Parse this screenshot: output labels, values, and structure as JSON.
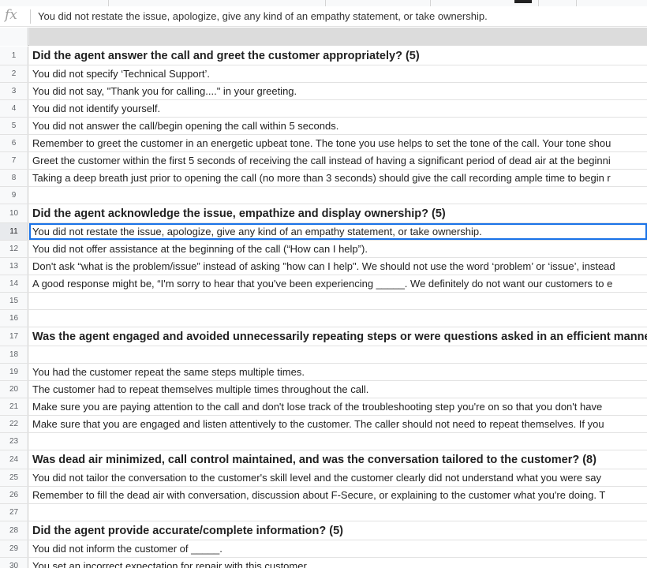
{
  "formula_bar": {
    "fx_label": "fx",
    "content": "You did not restate the issue, apologize, give any kind of an empathy statement, or take ownership."
  },
  "selected_row": "11",
  "rows": [
    {
      "num": "1",
      "text": "Did the agent answer the call and greet the customer appropriately? (5)",
      "kind": "question"
    },
    {
      "num": "2",
      "text": "You did not specify ‘Technical Support’.",
      "kind": "text"
    },
    {
      "num": "3",
      "text": "You did not say, \"Thank you for calling....\" in your greeting.",
      "kind": "text"
    },
    {
      "num": "4",
      "text": "You did not identify yourself.",
      "kind": "text"
    },
    {
      "num": "5",
      "text": "You did not answer the call/begin opening the call within 5 seconds.",
      "kind": "text"
    },
    {
      "num": "6",
      "text": "Remember to greet the customer in an energetic upbeat tone. The tone you use helps to set the tone of the call. Your tone shou",
      "kind": "text"
    },
    {
      "num": "7",
      "text": "Greet the customer within the first 5 seconds of receiving the call instead of having a significant period of dead air at the beginni",
      "kind": "text"
    },
    {
      "num": "8",
      "text": "Taking a deep breath just prior to opening the call (no more than 3 seconds) should give the call recording ample time to begin r",
      "kind": "text"
    },
    {
      "num": "9",
      "text": "",
      "kind": "text"
    },
    {
      "num": "10",
      "text": "Did the agent acknowledge the issue, empathize and display ownership? (5)",
      "kind": "question"
    },
    {
      "num": "11",
      "text": "You did not restate the issue, apologize, give any kind of an empathy statement, or take ownership.",
      "kind": "text"
    },
    {
      "num": "12",
      "text": "You did not offer assistance at the beginning of the call (“How can I help”).",
      "kind": "text"
    },
    {
      "num": "13",
      "text": "Don't ask “what is the problem/issue” instead of asking \"how can I help\". We should not use the word ‘problem’ or ‘issue’, instead",
      "kind": "text"
    },
    {
      "num": "14",
      "text": "A good response might be, “I'm sorry to hear that you've been experiencing _____. We definitely do not want our customers to e",
      "kind": "text"
    },
    {
      "num": "15",
      "text": "",
      "kind": "text"
    },
    {
      "num": "16",
      "text": "",
      "kind": "text"
    },
    {
      "num": "17",
      "text": "Was the agent engaged and avoided unnecessarily repeating steps or were questions asked in an efficient manner",
      "kind": "question"
    },
    {
      "num": "18",
      "text": "",
      "kind": "text"
    },
    {
      "num": "19",
      "text": "You had the customer repeat the same steps multiple times.",
      "kind": "text"
    },
    {
      "num": "20",
      "text": "The customer had to repeat themselves multiple times throughout the call.",
      "kind": "text"
    },
    {
      "num": "21",
      "text": "Make sure you are paying attention to the call and don't lose track of the troubleshooting step you're on so that you don't have",
      "kind": "text"
    },
    {
      "num": "22",
      "text": "Make sure that you are engaged and listen attentively to the customer. The caller should not need to repeat themselves. If you",
      "kind": "text"
    },
    {
      "num": "23",
      "text": "",
      "kind": "text"
    },
    {
      "num": "24",
      "text": "Was dead air minimized, call control maintained, and was the conversation tailored to the customer? (8)",
      "kind": "question"
    },
    {
      "num": "25",
      "text": "You did not tailor the conversation to the customer's skill level and the customer clearly did not understand what you were say",
      "kind": "text"
    },
    {
      "num": "26",
      "text": "Remember to fill the dead air with conversation, discussion about F-Secure, or explaining to the customer what you're doing. T",
      "kind": "text"
    },
    {
      "num": "27",
      "text": "",
      "kind": "text"
    },
    {
      "num": "28",
      "text": "Did the agent provide accurate/complete information? (5)",
      "kind": "question"
    },
    {
      "num": "29",
      "text": "You did not inform the customer of _____.",
      "kind": "text"
    },
    {
      "num": "30",
      "text": "You set an incorrect expectation for repair with this customer.",
      "kind": "text"
    }
  ]
}
